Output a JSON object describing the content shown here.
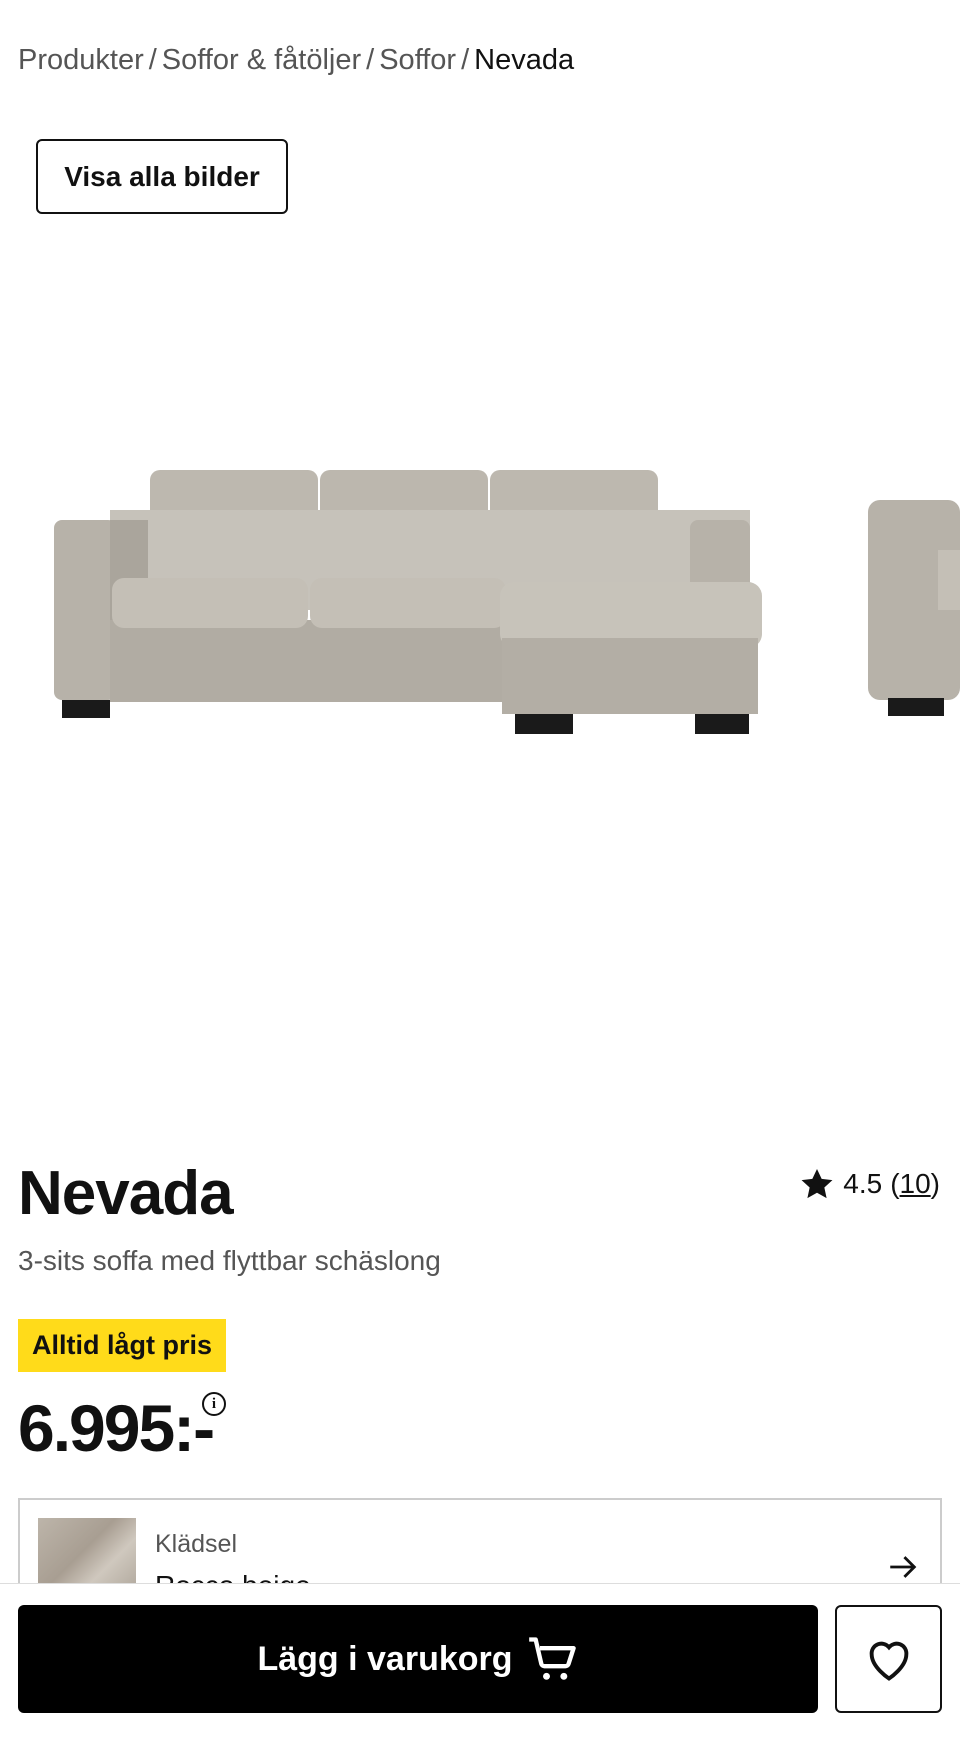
{
  "breadcrumb": {
    "items": [
      "Produkter",
      "Soffor & fåtöljer",
      "Soffor"
    ],
    "separator": "/",
    "current": "Nevada"
  },
  "gallery": {
    "show_all_label": "Visa alla bilder",
    "image_subject": "sofa with chaise longue, beige upholstery"
  },
  "product": {
    "name": "Nevada",
    "description": "3-sits soffa med flyttbar schäslong",
    "rating": "4.5",
    "rating_open": "(",
    "review_count": "10",
    "rating_close": ")",
    "badge": "Alltid lågt pris",
    "price": "6.995:-"
  },
  "option": {
    "label": "Klädsel",
    "value": "Rocco beige"
  },
  "actions": {
    "add_to_cart": "Lägg i varukorg"
  },
  "colors": {
    "badge_bg": "#ffdb1a",
    "cta_bg": "#000000",
    "sofa": "#b9b4ab"
  },
  "icons": {
    "star": "star-icon",
    "info": "info-icon",
    "arrow": "arrow-right-icon",
    "cart": "cart-icon",
    "wishlist": "heart-icon"
  }
}
